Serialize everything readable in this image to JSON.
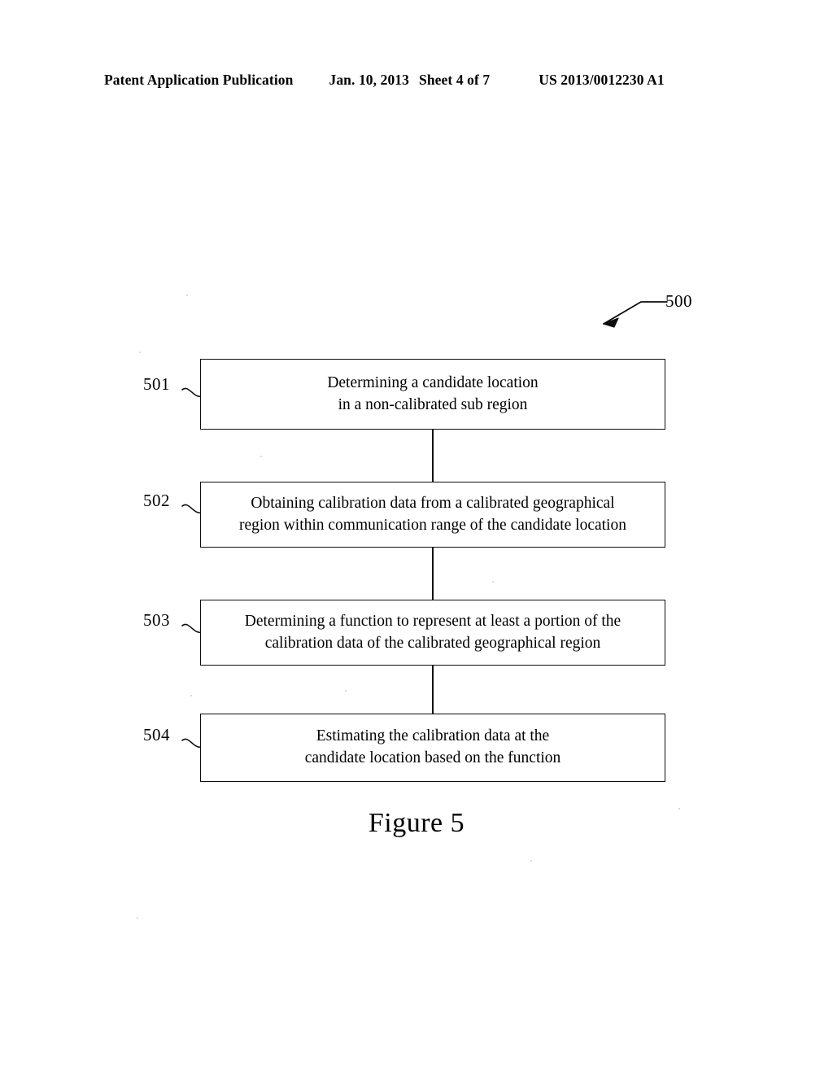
{
  "header": {
    "publication": "Patent Application Publication",
    "date": "Jan. 10, 2013",
    "sheet": "Sheet 4 of 7",
    "patent_number": "US 2013/0012230 A1"
  },
  "figure": {
    "caption": "Figure 5",
    "diagram_label": "500",
    "steps": [
      {
        "ref": "501",
        "lines": [
          "Determining a candidate location",
          "in a non-calibrated sub region"
        ]
      },
      {
        "ref": "502",
        "lines": [
          "Obtaining calibration data from a calibrated geographical",
          "region within communication range of the candidate location"
        ]
      },
      {
        "ref": "503",
        "lines": [
          "Determining a function to represent at least a portion of the",
          "calibration data of the calibrated geographical region"
        ]
      },
      {
        "ref": "504",
        "lines": [
          "Estimating the calibration data at the",
          "candidate location based on the function"
        ]
      }
    ]
  },
  "colors": {
    "page_background": "#ffffff",
    "ink": "#0d0d0d",
    "speckle": "#cfcfcf"
  }
}
